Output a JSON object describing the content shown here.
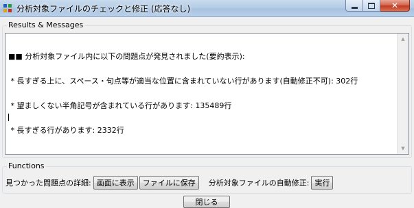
{
  "window": {
    "title": "分析対象ファイルのチェックと修正 (応答なし)",
    "controls": {
      "minimize": "",
      "maximize": "",
      "close": "✕"
    }
  },
  "results": {
    "group_label": "Results & Messages",
    "lines": [
      "■■ 分析対象ファイル内に以下の問題点が発見されました(要約表示):",
      " * 長すぎる上に、スペース・句点等が適当な位置に含まれていない行があります(自動修正不可): 302行",
      " * 望ましくない半角記号が含まれている行があります: 135489行",
      " * 長すぎる行があります: 2332行"
    ]
  },
  "functions": {
    "group_label": "Functions",
    "details_label": "見つかった問題点の詳細:",
    "show_on_screen_button": "画面に表示",
    "save_to_file_button": "ファイルに保存",
    "auto_fix_label": "分析対象ファイルの自動修正:",
    "execute_button": "実行"
  },
  "footer": {
    "close_button": "閉じる"
  },
  "colors": {
    "title_bar": "#b5cde6",
    "close_button": "#c0391f",
    "window_bg": "#f0f0f0"
  }
}
